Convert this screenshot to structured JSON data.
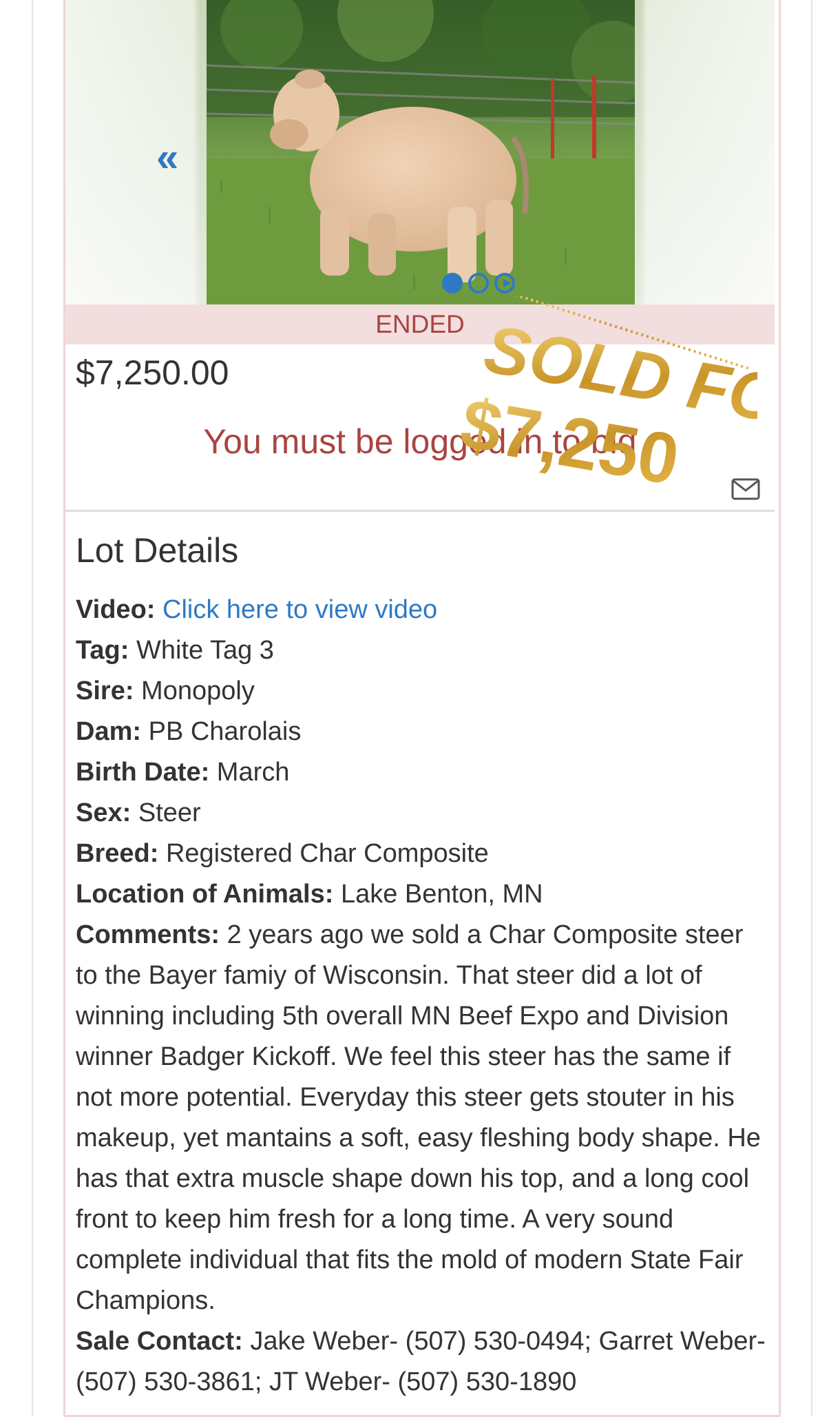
{
  "gallery": {
    "prev_icon": "chevron-double-left-icon",
    "next_icon": "chevron-double-right-icon",
    "dots": [
      "active",
      "inactive",
      "video"
    ]
  },
  "status": {
    "label": "ENDED"
  },
  "price": "$7,250.00",
  "login_message": "You must be logged in to bid",
  "sold_stamp": {
    "line1": "SOLD FOR",
    "line2": "$7,250",
    "color": "#d4a12a"
  },
  "details": {
    "title": "Lot Details",
    "video_label": "Video:",
    "video_link": "Click here to view video",
    "tag_label": "Tag:",
    "tag": "White Tag 3",
    "sire_label": "Sire:",
    "sire": "Monopoly",
    "dam_label": "Dam:",
    "dam": "PB Charolais",
    "birth_label": "Birth Date:",
    "birth": "March",
    "sex_label": "Sex:",
    "sex": "Steer",
    "breed_label": "Breed:",
    "breed": "Registered Char Composite",
    "location_label": "Location of Animals:",
    "location": "Lake Benton, MN",
    "comments_label": "Comments:",
    "comments": "2 years ago we sold a Char Composite steer to the Bayer famiy of Wisconsin. That steer did a lot of winning including 5th overall MN Beef Expo and Division winner Badger Kickoff. We feel this steer has the same if not more potential. Everyday this steer gets stouter in his makeup, yet mantains a soft, easy fleshing body shape. He has that extra muscle shape down his top, and a long cool front to keep him fresh for a long time. A very sound complete individual that fits the mold of modern State Fair Champions.",
    "contact_label": "Sale Contact:",
    "contact": "Jake Weber- (507) 530-0494; Garret Weber- (507) 530-3861; JT Weber- (507) 530-1890"
  },
  "colors": {
    "link": "#2f79c4",
    "danger": "#a94442",
    "ended_bg": "#f2dede"
  }
}
